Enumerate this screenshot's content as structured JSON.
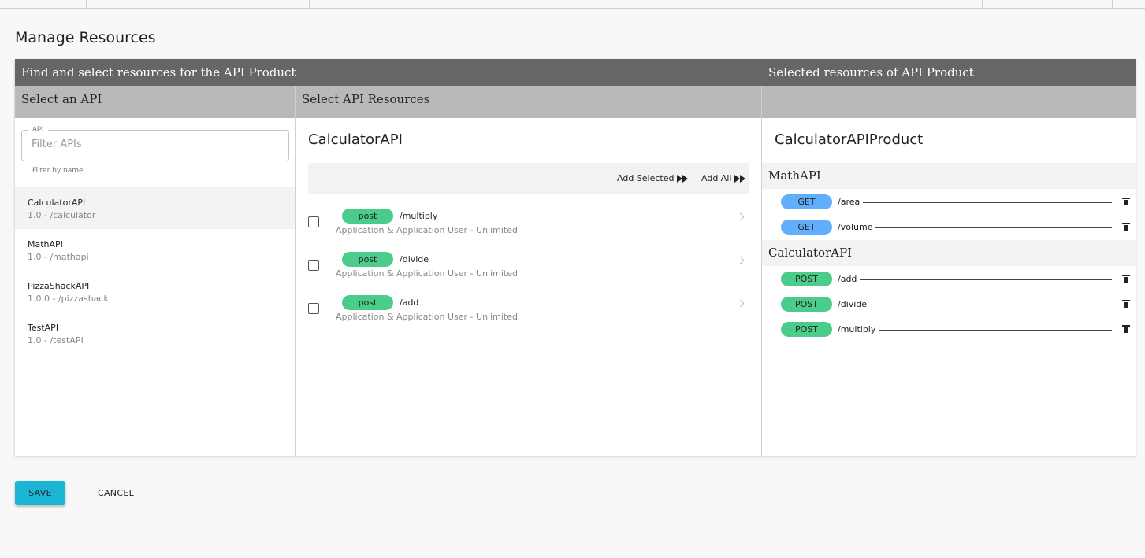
{
  "page": {
    "title": "Manage Resources"
  },
  "headers": {
    "find": "Find and select resources for the API Product",
    "selected": "Selected resources of API Product",
    "select_api": "Select an API",
    "select_resources": "Select API Resources"
  },
  "filter": {
    "legend": "API",
    "placeholder": "Filter APIs",
    "help": "Filter by name"
  },
  "apis": [
    {
      "name": "CalculatorAPI",
      "sub": "1.0 - /calculator"
    },
    {
      "name": "MathAPI",
      "sub": "1.0 - /mathapi"
    },
    {
      "name": "PizzaShackAPI",
      "sub": "1.0.0 - /pizzashack"
    },
    {
      "name": "TestAPI",
      "sub": "1.0 - /testAPI"
    }
  ],
  "middle": {
    "title": "CalculatorAPI",
    "add_selected": "Add Selected",
    "add_all": "Add All",
    "resources": [
      {
        "verb": "post",
        "path": "/multiply",
        "sub": "Application & Application User - Unlimited"
      },
      {
        "verb": "post",
        "path": "/divide",
        "sub": "Application & Application User - Unlimited"
      },
      {
        "verb": "post",
        "path": "/add",
        "sub": "Application & Application User - Unlimited"
      }
    ]
  },
  "right": {
    "title": "CalculatorAPIProduct",
    "groups": [
      {
        "name": "MathAPI",
        "items": [
          {
            "verb": "GET",
            "path": "/area"
          },
          {
            "verb": "GET",
            "path": "/volume"
          }
        ]
      },
      {
        "name": "CalculatorAPI",
        "items": [
          {
            "verb": "POST",
            "path": "/add"
          },
          {
            "verb": "POST",
            "path": "/divide"
          },
          {
            "verb": "POST",
            "path": "/multiply"
          }
        ]
      }
    ]
  },
  "buttons": {
    "save": "SAVE",
    "cancel": "CANCEL"
  },
  "colors": {
    "post": "#4ccc8a",
    "get": "#61aefc",
    "save": "#1cb5d3"
  }
}
